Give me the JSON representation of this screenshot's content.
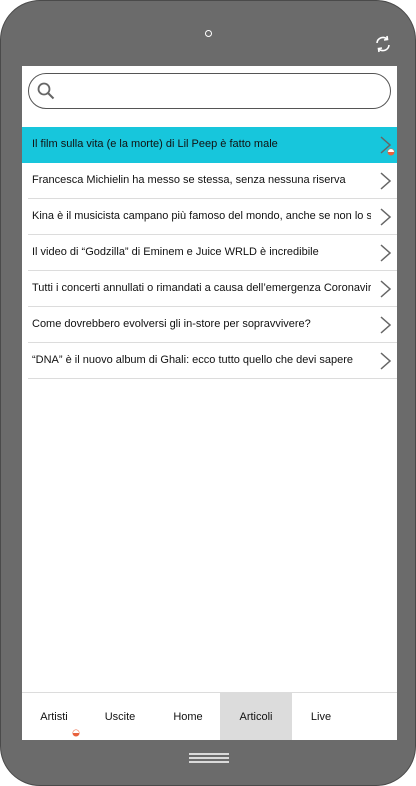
{
  "search": {
    "placeholder": "",
    "value": ""
  },
  "articles": [
    {
      "title": "Il film sulla vita (e la morte) di Lil Peep è fatto male",
      "selected": true
    },
    {
      "title": "Francesca Michielin ha messo se stessa, senza nessuna riserva"
    },
    {
      "title": "Kina è il musicista campano più famoso del mondo, anche se non lo sai"
    },
    {
      "title": "Il video di “Godzilla” di Eminem e Juice WRLD è incredibile"
    },
    {
      "title": "Tutti i concerti annullati o rimandati a causa dell’emergenza Coronavirus"
    },
    {
      "title": "Come dovrebbero evolversi gli in-store per sopravvivere?"
    },
    {
      "title": "“DNA” è il nuovo album di Ghali: ecco tutto quello che devi sapere"
    }
  ],
  "tabs": [
    {
      "label": "Artisti"
    },
    {
      "label": "Uscite"
    },
    {
      "label": "Home"
    },
    {
      "label": "Articoli",
      "active": true
    },
    {
      "label": "Live"
    }
  ],
  "colors": {
    "accent": "#17c6dc",
    "badge": "#e8613c",
    "device": "#6b6b6b",
    "active_tab": "#dcdcdc"
  }
}
